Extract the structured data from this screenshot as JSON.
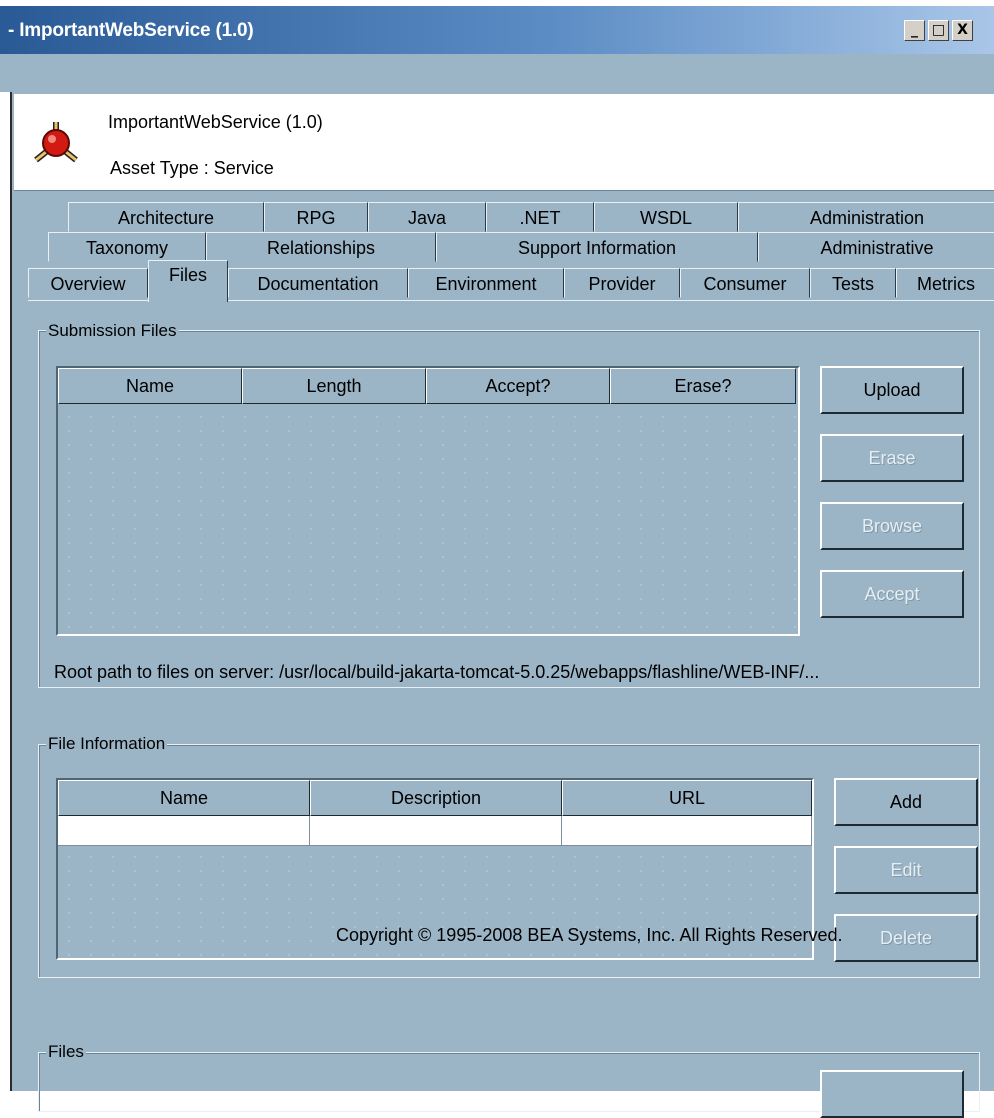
{
  "window": {
    "title": "- ImportantWebService (1.0)",
    "buttons": {
      "minimize": "_",
      "maximize": "□",
      "close": "X"
    }
  },
  "header": {
    "asset_name": "ImportantWebService (1.0)",
    "asset_type": "Asset Type : Service"
  },
  "tabs": {
    "row1": [
      "Architecture",
      "RPG",
      "Java",
      ".NET",
      "WSDL",
      "Administration"
    ],
    "row2": [
      "Taxonomy",
      "Relationships",
      "Support Information",
      "Administrative"
    ],
    "row3": [
      "Overview",
      "Files",
      "Documentation",
      "Environment",
      "Provider",
      "Consumer",
      "Tests",
      "Metrics"
    ],
    "selected": "Files"
  },
  "submission_files": {
    "legend": "Submission Files",
    "columns": [
      "Name",
      "Length",
      "Accept?",
      "Erase?"
    ],
    "rows": [],
    "buttons": {
      "upload": "Upload",
      "erase": "Erase",
      "browse": "Browse",
      "accept": "Accept"
    },
    "root_path": "Root path to files on server: /usr/local/build-jakarta-tomcat-5.0.25/webapps/flashline/WEB-INF/..."
  },
  "file_information": {
    "legend": "File Information",
    "columns": [
      "Name",
      "Description",
      "URL"
    ],
    "rows": [
      [
        "",
        "",
        ""
      ]
    ],
    "buttons": {
      "add": "Add",
      "edit": "Edit",
      "delete": "Delete"
    }
  },
  "files": {
    "legend": "Files"
  },
  "footer": {
    "copyright": "Copyright © 1995-2008 BEA Systems, Inc. All Rights Reserved."
  },
  "colors": {
    "panel": "#9bb5c6",
    "titlebar_start": "#2a5a96",
    "titlebar_end": "#a9c6e8",
    "logo_red": "#d21a12"
  },
  "icons": {
    "asset_logo": "molecule-asset-icon"
  }
}
